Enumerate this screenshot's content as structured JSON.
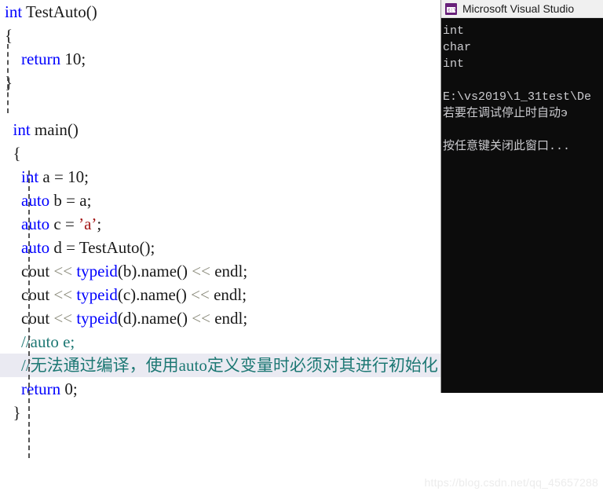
{
  "editor": {
    "name": "code-editor",
    "language": "cpp",
    "lines": [
      {
        "id": "l1",
        "indent": 0,
        "highlight": false,
        "tokens": [
          {
            "t": "kw",
            "v": "int"
          },
          {
            "t": "id",
            "v": " TestAuto()"
          }
        ]
      },
      {
        "id": "l2",
        "indent": 0,
        "highlight": false,
        "tokens": [
          {
            "t": "brace",
            "v": "{"
          }
        ]
      },
      {
        "id": "l3",
        "indent": 0,
        "highlight": false,
        "tokens": [
          {
            "t": "id",
            "v": "    "
          },
          {
            "t": "kw",
            "v": "return"
          },
          {
            "t": "id",
            "v": " "
          },
          {
            "t": "num",
            "v": "10"
          },
          {
            "t": "id",
            "v": ";"
          }
        ]
      },
      {
        "id": "l4",
        "indent": 0,
        "highlight": false,
        "tokens": [
          {
            "t": "brace",
            "v": "}"
          }
        ]
      },
      {
        "id": "l5",
        "indent": 0,
        "highlight": false,
        "tokens": [
          {
            "t": "id",
            "v": ""
          }
        ]
      },
      {
        "id": "l6",
        "indent": 1,
        "highlight": false,
        "tokens": [
          {
            "t": "id",
            "v": "  "
          },
          {
            "t": "kw",
            "v": "int"
          },
          {
            "t": "id",
            "v": " main()"
          }
        ]
      },
      {
        "id": "l7",
        "indent": 1,
        "highlight": false,
        "tokens": [
          {
            "t": "id",
            "v": "  "
          },
          {
            "t": "brace",
            "v": "{"
          }
        ]
      },
      {
        "id": "l8",
        "indent": 1,
        "highlight": false,
        "tokens": [
          {
            "t": "id",
            "v": "    "
          },
          {
            "t": "kw",
            "v": "int"
          },
          {
            "t": "id",
            "v": " a = "
          },
          {
            "t": "num",
            "v": "10"
          },
          {
            "t": "id",
            "v": ";"
          }
        ]
      },
      {
        "id": "l9",
        "indent": 1,
        "highlight": false,
        "tokens": [
          {
            "t": "id",
            "v": "    "
          },
          {
            "t": "kw",
            "v": "auto"
          },
          {
            "t": "id",
            "v": " b = a;"
          }
        ]
      },
      {
        "id": "l10",
        "indent": 1,
        "highlight": false,
        "tokens": [
          {
            "t": "id",
            "v": "    "
          },
          {
            "t": "kw",
            "v": "auto"
          },
          {
            "t": "id",
            "v": " c = "
          },
          {
            "t": "str",
            "v": "’a’"
          },
          {
            "t": "id",
            "v": ";"
          }
        ]
      },
      {
        "id": "l11",
        "indent": 1,
        "highlight": false,
        "tokens": [
          {
            "t": "id",
            "v": "    "
          },
          {
            "t": "kw",
            "v": "auto"
          },
          {
            "t": "id",
            "v": " d = TestAuto();"
          }
        ]
      },
      {
        "id": "l12",
        "indent": 1,
        "highlight": false,
        "tokens": [
          {
            "t": "id",
            "v": "    cout "
          },
          {
            "t": "op",
            "v": "<<"
          },
          {
            "t": "id",
            "v": " "
          },
          {
            "t": "kw",
            "v": "typeid"
          },
          {
            "t": "id",
            "v": "(b).name() "
          },
          {
            "t": "op",
            "v": "<<"
          },
          {
            "t": "id",
            "v": " endl;"
          }
        ]
      },
      {
        "id": "l13",
        "indent": 1,
        "highlight": false,
        "tokens": [
          {
            "t": "id",
            "v": "    cout "
          },
          {
            "t": "op",
            "v": "<<"
          },
          {
            "t": "id",
            "v": " "
          },
          {
            "t": "kw",
            "v": "typeid"
          },
          {
            "t": "id",
            "v": "(c).name() "
          },
          {
            "t": "op",
            "v": "<<"
          },
          {
            "t": "id",
            "v": " endl;"
          }
        ]
      },
      {
        "id": "l14",
        "indent": 1,
        "highlight": false,
        "tokens": [
          {
            "t": "id",
            "v": "    cout "
          },
          {
            "t": "op",
            "v": "<<"
          },
          {
            "t": "id",
            "v": " "
          },
          {
            "t": "kw",
            "v": "typeid"
          },
          {
            "t": "id",
            "v": "(d).name() "
          },
          {
            "t": "op",
            "v": "<<"
          },
          {
            "t": "id",
            "v": " endl;"
          }
        ]
      },
      {
        "id": "l15",
        "indent": 1,
        "highlight": false,
        "tokens": [
          {
            "t": "id",
            "v": "    "
          },
          {
            "t": "com",
            "v": "//auto e;"
          }
        ]
      },
      {
        "id": "l16",
        "indent": 1,
        "highlight": true,
        "tokens": [
          {
            "t": "id",
            "v": "    "
          },
          {
            "t": "com",
            "v": "//无法通过编译，使用auto定义变量时必须对其进行初始化"
          }
        ]
      },
      {
        "id": "l17",
        "indent": 1,
        "highlight": false,
        "tokens": [
          {
            "t": "id",
            "v": "    "
          },
          {
            "t": "kw",
            "v": "return"
          },
          {
            "t": "id",
            "v": " "
          },
          {
            "t": "num",
            "v": "0"
          },
          {
            "t": "id",
            "v": ";"
          }
        ]
      },
      {
        "id": "l18",
        "indent": 1,
        "highlight": false,
        "tokens": [
          {
            "t": "id",
            "v": "  "
          },
          {
            "t": "brace",
            "v": "}"
          }
        ]
      }
    ],
    "colors": {
      "keyword": "#0000ff",
      "identifier": "#1a1a1a",
      "string": "#a31515",
      "comment": "#1d7874",
      "operator": "#8a8a7a",
      "highlight_background": "#eaeaf2",
      "background": "#ffffff"
    }
  },
  "console": {
    "title": "Microsoft Visual Studio",
    "icon": "console-window-icon",
    "icon_color": "#68217a",
    "background": "#0c0c0c",
    "text_color": "#ccccd0",
    "output_lines": [
      "int",
      "char",
      "int",
      "",
      "E:\\vs2019\\1_31test\\De",
      "若要在调试停止时自动э",
      "",
      "按任意键关闭此窗口..."
    ]
  },
  "watermark": {
    "text": "https://blog.csdn.net/qq_45657288",
    "color": "#ececec"
  }
}
